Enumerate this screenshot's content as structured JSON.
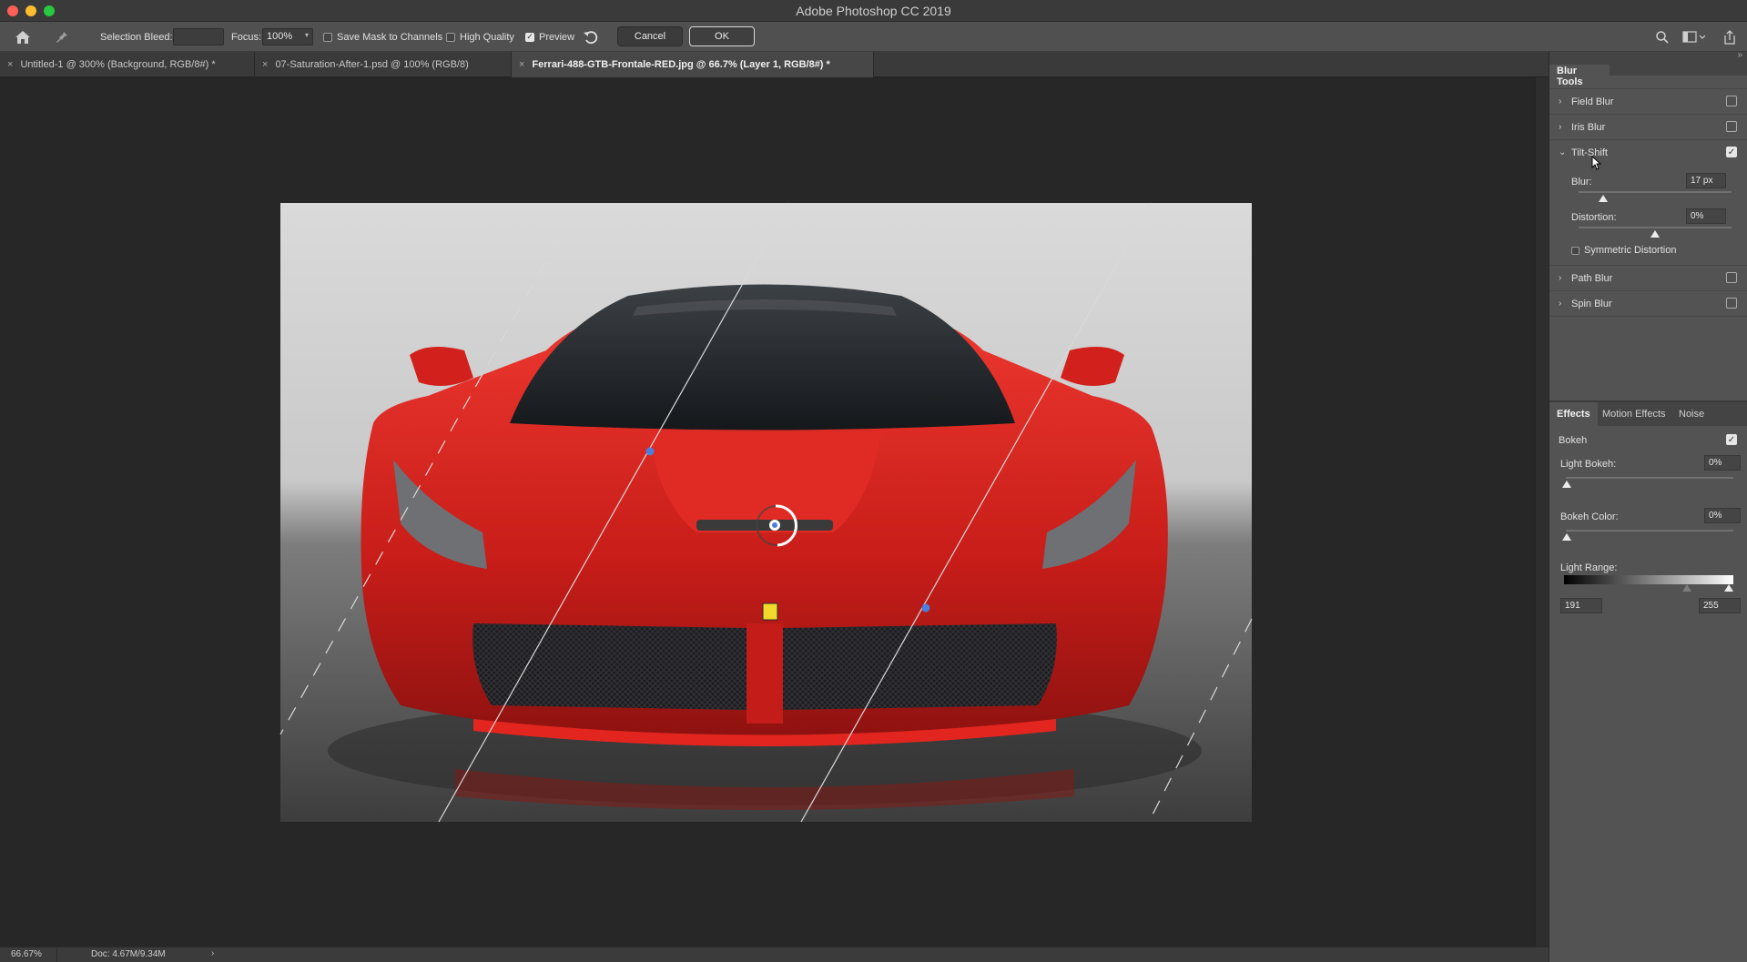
{
  "window": {
    "title": "Adobe Photoshop CC 2019"
  },
  "options_bar": {
    "selection_bleed_label": "Selection Bleed:",
    "selection_bleed_value": "",
    "focus_label": "Focus:",
    "focus_value": "100%",
    "save_mask_label": "Save Mask to Channels",
    "high_quality_label": "High Quality",
    "preview_label": "Preview",
    "preview_checked": true,
    "cancel_label": "Cancel",
    "ok_label": "OK"
  },
  "tabs": [
    {
      "label": "Untitled-1 @ 300% (Background, RGB/8#) *"
    },
    {
      "label": "07-Saturation-After-1.psd @ 100% (RGB/8)"
    },
    {
      "label": "Ferrari-488-GTB-Frontale-RED.jpg @ 66.7% (Layer 1, RGB/8#) *"
    }
  ],
  "status_bar": {
    "zoom": "66.67%",
    "doc": "Doc: 4.67M/9.34M"
  },
  "blur_tools": {
    "panel_title": "Blur Tools",
    "items": [
      {
        "label": "Field Blur",
        "checked": false
      },
      {
        "label": "Iris Blur",
        "checked": false
      },
      {
        "label": "Tilt-Shift",
        "checked": true
      },
      {
        "label": "Path Blur",
        "checked": false
      },
      {
        "label": "Spin Blur",
        "checked": false
      }
    ],
    "tilt_shift": {
      "blur_label": "Blur:",
      "blur_value": "17 px",
      "blur_level": 0.16,
      "distortion_label": "Distortion:",
      "distortion_value": "0%",
      "distortion_level": 0.5,
      "symmetric_label": "Symmetric Distortion"
    }
  },
  "effects": {
    "tabs": [
      "Effects",
      "Motion Effects",
      "Noise"
    ],
    "bokeh_label": "Bokeh",
    "bokeh_checked": true,
    "light_bokeh_label": "Light Bokeh:",
    "light_bokeh_value": "0%",
    "bokeh_color_label": "Bokeh Color:",
    "bokeh_color_value": "0%",
    "light_range_label": "Light Range:",
    "light_range_low": "191",
    "light_range_high": "255"
  },
  "colors": {
    "ui_dark": "#262626",
    "panel": "#535353",
    "pin_blue": "#4a7fe0",
    "car_red": "#d8231f"
  }
}
